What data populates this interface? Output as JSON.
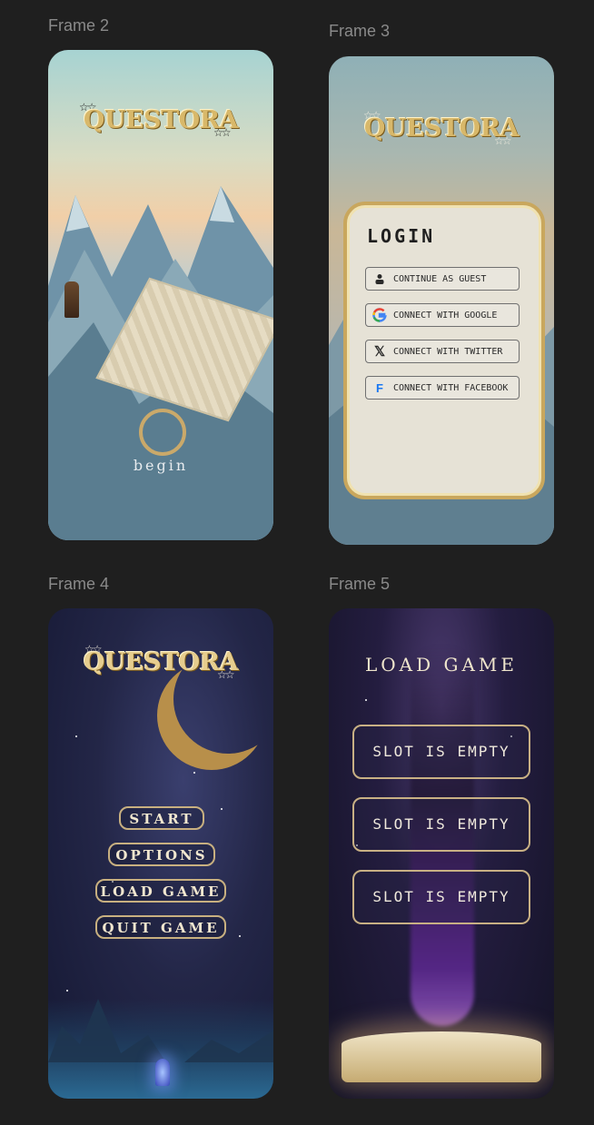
{
  "canvas": {
    "frames": [
      {
        "label": "Frame 2"
      },
      {
        "label": "Frame 3"
      },
      {
        "label": "Frame 4"
      },
      {
        "label": "Frame 5"
      }
    ]
  },
  "frame2": {
    "logo": "QUESTORA",
    "begin_label": "begin"
  },
  "frame3": {
    "logo": "QUESTORA",
    "login": {
      "title": "LOGIN",
      "buttons": [
        {
          "label": "CONTINUE AS GUEST",
          "icon": "user-icon"
        },
        {
          "label": "CONNECT WITH GOOGLE",
          "icon": "google-icon"
        },
        {
          "label": "CONNECT WITH TWITTER",
          "icon": "x-twitter-icon"
        },
        {
          "label": "CONNECT WITH FACEBOOK",
          "icon": "facebook-icon"
        }
      ]
    }
  },
  "frame4": {
    "logo": "QUESTORA",
    "menu": [
      {
        "label": "START"
      },
      {
        "label": "OPTIONS"
      },
      {
        "label": "LOAD GAME"
      },
      {
        "label": "QUIT GAME"
      }
    ]
  },
  "frame5": {
    "title": "LOAD GAME",
    "slots": [
      {
        "label": "SLOT IS EMPTY"
      },
      {
        "label": "SLOT IS EMPTY"
      },
      {
        "label": "SLOT IS EMPTY"
      }
    ]
  },
  "colors": {
    "canvas_bg": "#1f1f1f",
    "gold": "#c9a75d",
    "frame_label": "#8a8a8a"
  }
}
